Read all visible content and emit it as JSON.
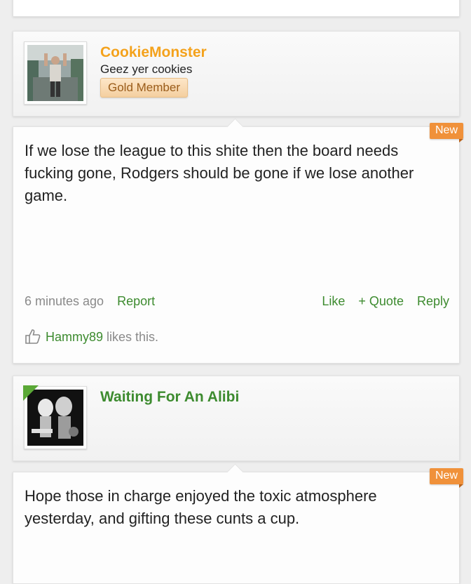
{
  "posts": [
    {
      "username": "CookieMonster",
      "user_title": "Geez yer cookies",
      "badge": "Gold Member",
      "new_label": "New",
      "message": "If we lose the league to this shite then the board needs fucking gone, Rodgers should be gone if we lose another game.",
      "time": "6 minutes ago",
      "report": "Report",
      "like": "Like",
      "quote": "+ Quote",
      "reply": "Reply",
      "liker": "Hammy89",
      "likes_suffix": " likes this."
    },
    {
      "username": "Waiting For An Alibi",
      "new_label": "New",
      "message": "Hope those in charge enjoyed the toxic atmosphere yesterday, and gifting these cunts a cup."
    }
  ],
  "colors": {
    "accent_green": "#3d8b2f",
    "username_orange": "#f4a21c",
    "new_tag": "#f0913a"
  }
}
